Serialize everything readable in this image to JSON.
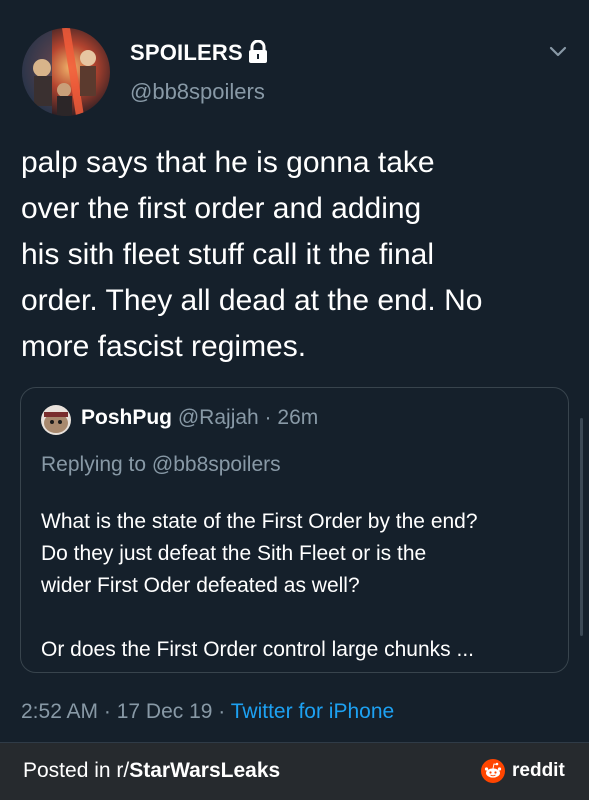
{
  "tweet": {
    "display_name": "SPOILERS",
    "handle": "@bb8spoilers",
    "text": "palp says that he is gonna take\nover the first order and adding\nhis sith fleet stuff call it the final\norder. They all dead at the end. No\nmore fascist regimes.",
    "icons": {
      "lock": "lock-icon",
      "menu": "chevron-down-icon"
    }
  },
  "quoted_tweet": {
    "name": "PoshPug",
    "handle": "@Rajjah",
    "separator": " · ",
    "time": "26m",
    "replying_to": "Replying to @bb8spoilers",
    "text": "What is the state of the First Order by the end?\nDo they just defeat the Sith Fleet or is the\nwider First Oder defeated as well?\n\nOr does the First Order control large chunks ..."
  },
  "meta": {
    "time": "2:52 AM",
    "separator": " · ",
    "date": "17 Dec 19",
    "separator2": " · ",
    "source": "Twitter for iPhone"
  },
  "reddit_bar": {
    "prefix": "Posted in r/",
    "subreddit": "StarWarsLeaks",
    "brand": "reddit"
  },
  "colors": {
    "background": "#15202b",
    "secondary_text": "#8899a6",
    "link": "#1da1f2",
    "reddit_orange": "#ff4500",
    "bar": "#262a2e"
  }
}
